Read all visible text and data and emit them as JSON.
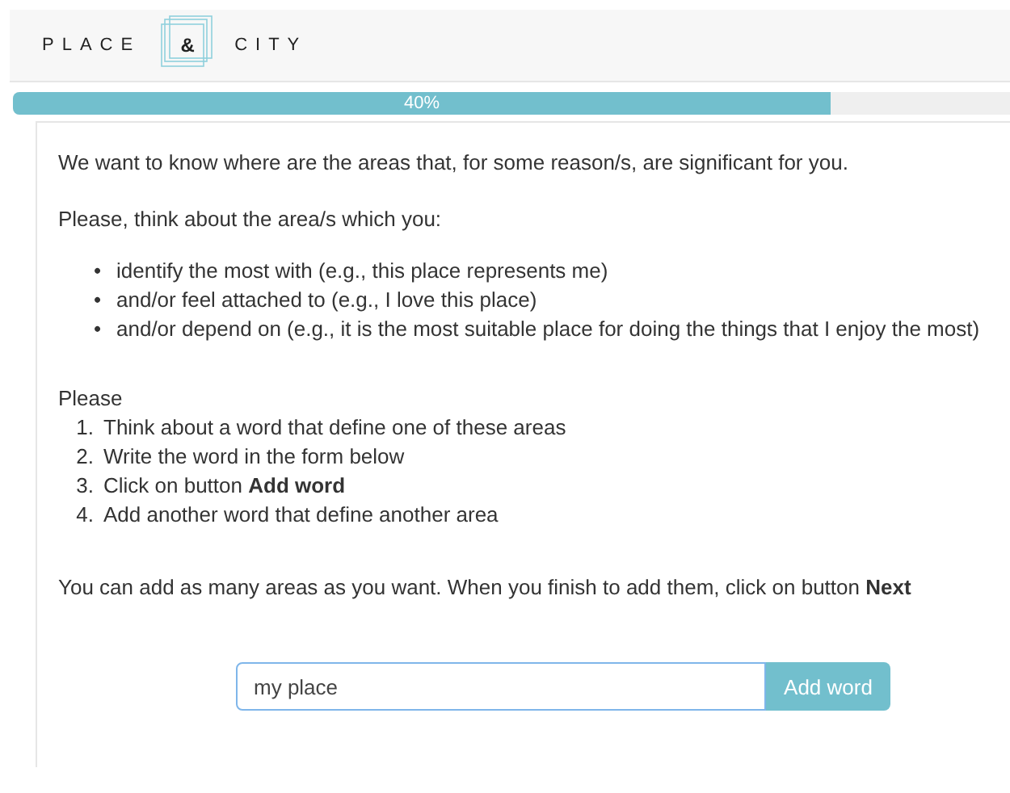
{
  "header": {
    "logo": {
      "left": "PLACE",
      "middle": "&",
      "right": "CITY"
    }
  },
  "progress": {
    "label": "40%",
    "level": 0.82
  },
  "intro": "We want to know where are the areas that, for some reason/s, are significant for you.",
  "prompt": "Please, think about the area/s which you:",
  "bullets": [
    {
      "marker": "•",
      "text": "identify the most with (e.g., this place represents me)"
    },
    {
      "marker": "•",
      "text": "and/or feel attached to (e.g., I love this place)"
    },
    {
      "marker": "•",
      "text": "and/or depend on (e.g., it is the most suitable place for doing the things that I enjoy the most)"
    }
  ],
  "steps_heading": "Please",
  "steps": [
    {
      "number": "1.",
      "text": "Think about a word that define one of these areas"
    },
    {
      "number": "2.",
      "text": "Write the word in the form below"
    },
    {
      "number": "3.",
      "text": "Click on button **Add word**"
    },
    {
      "number": "4.",
      "text": "Add another word that define another area"
    }
  ],
  "note": "You can add as many areas as you want. When you finish to add them, click on button **Next**",
  "form": {
    "value": "my place",
    "button": "Add word"
  }
}
